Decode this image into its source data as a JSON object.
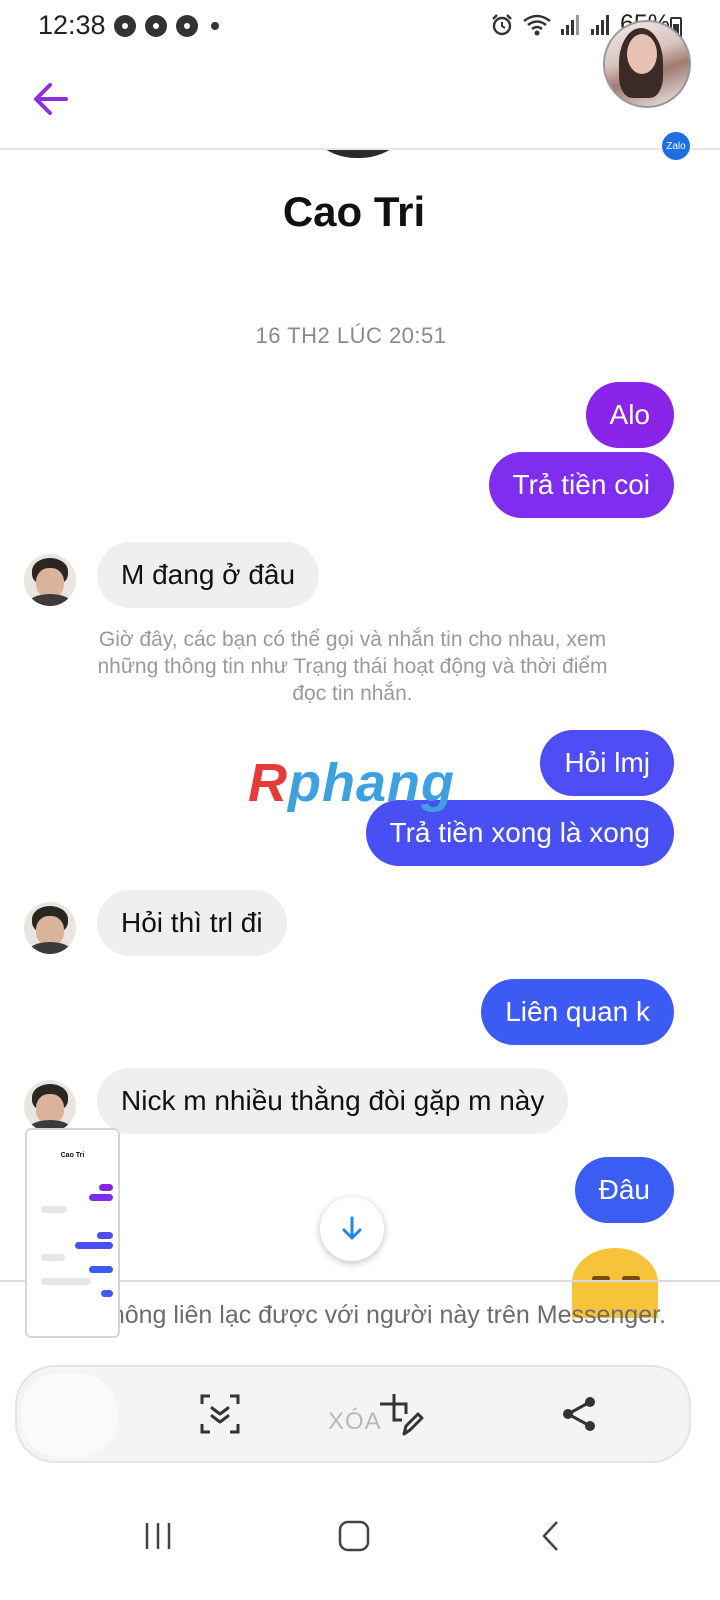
{
  "status_bar": {
    "time": "12:38",
    "left_icons": [
      "chrome-icon",
      "chrome-icon",
      "chrome-icon",
      "dot-icon"
    ],
    "right_icons": [
      "alarm-icon",
      "wifi-icon",
      "signal-icon",
      "signal-icon",
      "battery-icon"
    ],
    "battery": "65%"
  },
  "header": {
    "back_icon": "arrow-left-icon",
    "avatar_badge": "Zalo",
    "accent_color": "#8e2de2"
  },
  "profile": {
    "name": "Cao Tri"
  },
  "conversation": {
    "timestamp": "16 TH2 LÚC 20:51",
    "messages": [
      {
        "side": "out",
        "text": "Alo",
        "color": "#8a24e8"
      },
      {
        "side": "out",
        "text": "Trả tiền coi",
        "color": "#7f2ef0"
      },
      {
        "side": "in",
        "text": "M đang ở đâu"
      },
      {
        "side": "out",
        "text": "Hỏi lmj",
        "color": "#4f4df5"
      },
      {
        "side": "out",
        "text": "Trả tiền xong là xong",
        "color": "#4850f4"
      },
      {
        "side": "in",
        "text": "Hỏi thì trl đi"
      },
      {
        "side": "out",
        "text": "Liên quan k",
        "color": "#3c5bf5"
      },
      {
        "side": "in",
        "text": "Nick m nhiều thằng đòi gặp m này"
      },
      {
        "side": "out",
        "text": "Đâu",
        "color": "#3a5df4"
      }
    ],
    "system_note": "Giờ đây, các bạn có thể gọi và nhắn tin cho nhau, xem những thông tin như Trạng thái hoạt động và thời điểm đọc tin nhắn."
  },
  "watermark": {
    "first": "R",
    "rest": "phang"
  },
  "footer": {
    "unavailable": "Hiện không liên lạc được với người này trên Messenger."
  },
  "screenshot_toolbar": {
    "delete_label": "XÓA",
    "tools": [
      "scroll-capture-icon",
      "crop-edit-icon",
      "share-icon"
    ]
  },
  "thumbnail": {
    "title": "Cao Tri"
  },
  "navbar": {
    "buttons": [
      "recents-icon",
      "home-icon",
      "back-icon"
    ]
  }
}
